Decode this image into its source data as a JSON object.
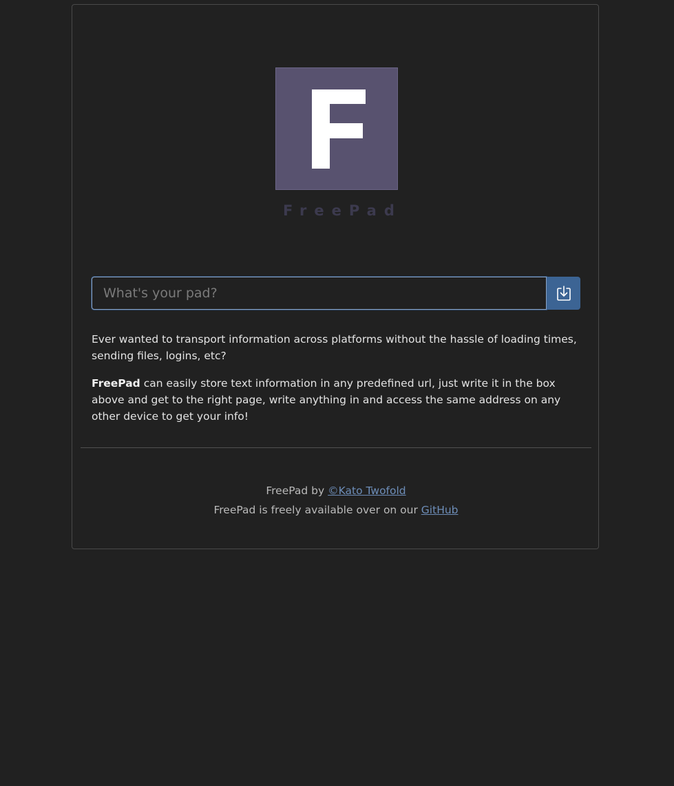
{
  "logo": {
    "letter": "F",
    "brand_name": "FreePad"
  },
  "search": {
    "placeholder": "What's your pad?",
    "value": "",
    "button_icon": "download-icon"
  },
  "description": {
    "paragraph1": "Ever wanted to transport information across platforms without the hassle of loading times, sending files, logins, etc?",
    "paragraph2_bold": "FreePad",
    "paragraph2_rest": " can easily store text information in any predefined url, just write it in the box above and get to the right page, write anything in and access the same address on any other device to get your info!"
  },
  "footer": {
    "line1_prefix": "FreePad by ",
    "author_link": "©Kato Twofold",
    "line2_prefix": "FreePad is freely available over on our ",
    "github_link": "GitHub"
  },
  "colors": {
    "background": "#212121",
    "logo_bg": "#58526f",
    "accent_button": "#3c6494",
    "link": "#6d8db8"
  }
}
